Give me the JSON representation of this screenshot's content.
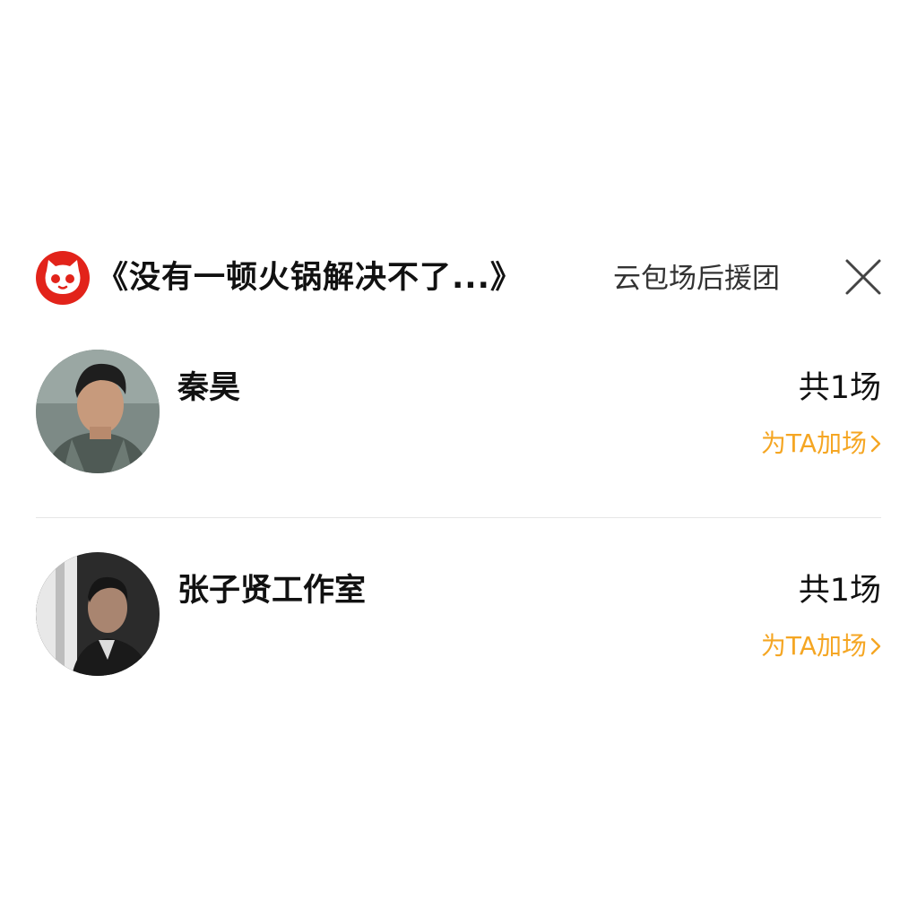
{
  "header": {
    "title": "《没有一顿火锅解决不了...》",
    "subtitle": "云包场后援团",
    "logo_icon": "maoyan-cat-logo-icon",
    "close_icon": "close-icon",
    "brand_color": "#e2231a"
  },
  "list": [
    {
      "name": "秦昊",
      "count": "共1场",
      "action": "为TA加场"
    },
    {
      "name": "张子贤工作室",
      "count": "共1场",
      "action": "为TA加场"
    }
  ],
  "colors": {
    "accent": "#f5a623",
    "text": "#111111",
    "divider": "#e6e6e6"
  }
}
